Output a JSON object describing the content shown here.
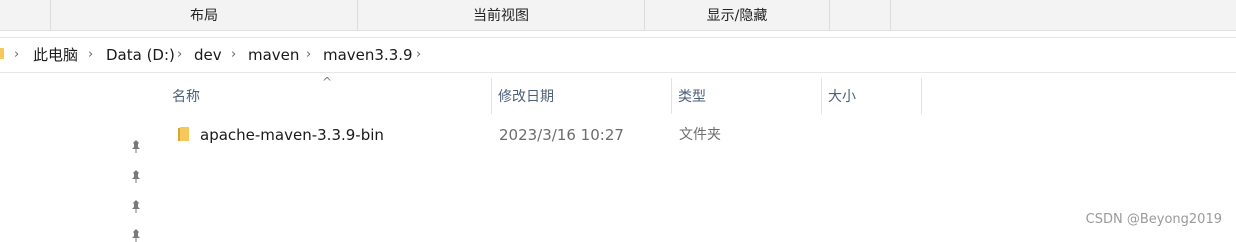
{
  "ribbon": {
    "groups": [
      "布局",
      "当前视图",
      "显示/隐藏"
    ]
  },
  "address": {
    "crumbs": [
      "此电脑",
      "Data (D:)",
      "dev",
      "maven",
      "maven3.3.9"
    ]
  },
  "columns": [
    "名称",
    "修改日期",
    "类型",
    "大小"
  ],
  "rows": [
    {
      "name": "apache-maven-3.3.9-bin",
      "modified": "2023/3/16 10:27",
      "type": "文件夹",
      "size": "",
      "icon": "folder-icon"
    }
  ],
  "sort": {
    "column": "名称",
    "direction": "ascending",
    "icon": "sort-caret-up-icon"
  },
  "quick_access_pins": {
    "count": 4,
    "icon": "pin-icon"
  },
  "watermark": "CSDN @Beyong2019",
  "colors": {
    "ribbon_bg": "#f3f3f3",
    "folder": "#f4c85a",
    "header_text": "#4c607a",
    "secondary_text": "#6d6d6d"
  }
}
